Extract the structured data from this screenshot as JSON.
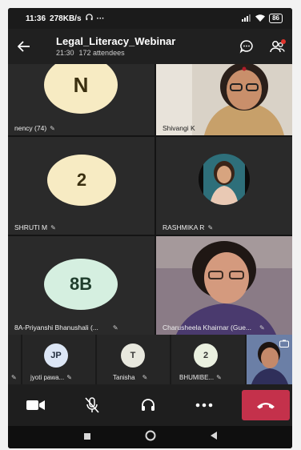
{
  "status": {
    "time": "11:36",
    "speed": "278KB/s",
    "more": "···",
    "battery": "86"
  },
  "header": {
    "title": "Legal_Literacy_Webinar",
    "elapsed": "21:30",
    "attendees": "172 attendees"
  },
  "grid": [
    {
      "initials": "N",
      "name": "nency (74)"
    },
    {
      "name": "Shivangi K"
    },
    {
      "initials": "2",
      "name": "SHRUTI M"
    },
    {
      "name": "RASHMIKA R"
    },
    {
      "initials": "8B",
      "name": "8A-Priyanshi Bhanushali (..."
    },
    {
      "name": "Charusheela Khairnar (Gue..."
    }
  ],
  "strip": [
    {
      "initials": "JP",
      "name": "jyoti pawa..."
    },
    {
      "initials": "T",
      "name": "Tanisha"
    },
    {
      "initials": "2",
      "name": "BHUMIBE..."
    }
  ],
  "colors": {
    "avatar_yellow": "#f7ebc3",
    "avatar_green": "#d5efe0",
    "avatar_blue": "#dce6f5",
    "end_call": "#c4314b"
  }
}
